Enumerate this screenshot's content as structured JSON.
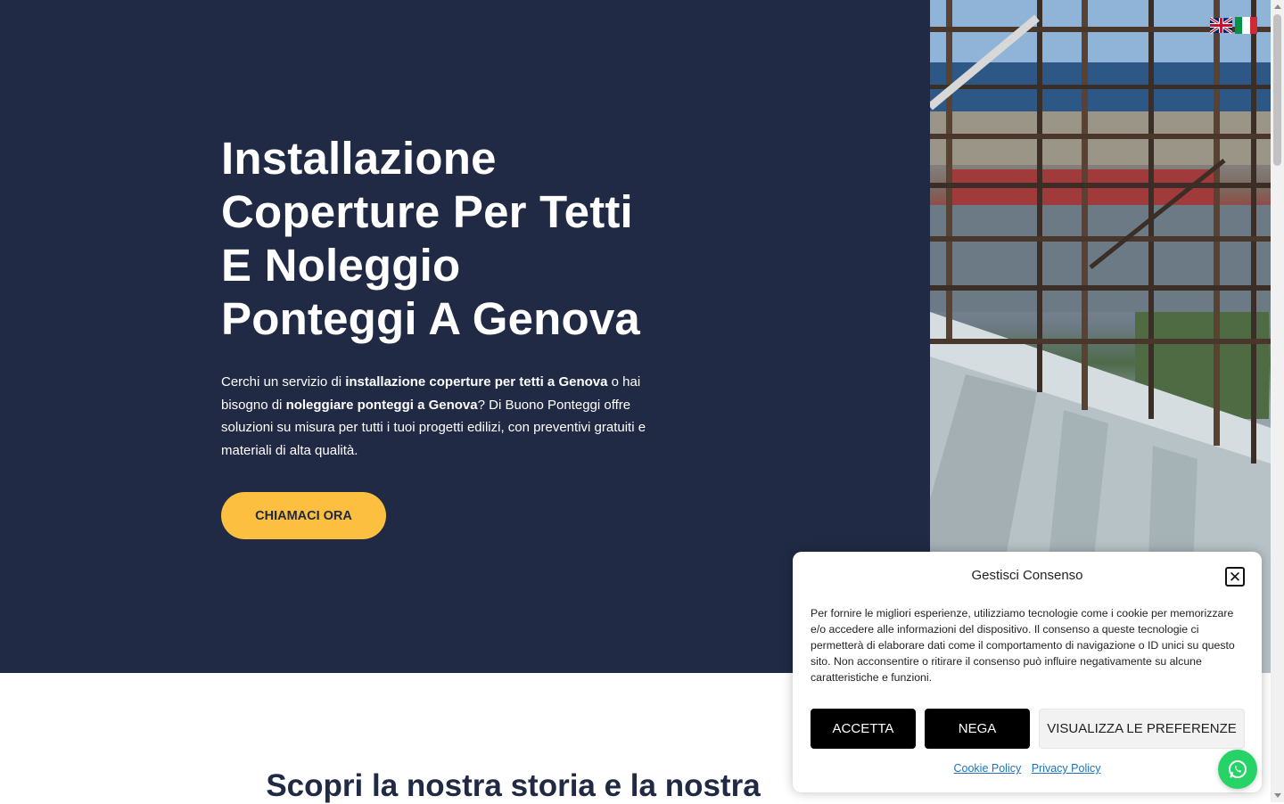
{
  "hero": {
    "title": "Installazione Coperture Per Tetti E Noleggio Ponteggi A Genova",
    "text_parts": [
      "Cerchi un servizio di ",
      "installazione coperture per tetti a Genova",
      " o hai bisogno di ",
      "noleggiare ponteggi a Genova",
      "? Di Buono Ponteggi offre soluzioni su misura per tutti i tuoi progetti edilizi, con preventivi gratuiti e materiali di alta qualità."
    ],
    "cta_label": "CHIAMACI ORA",
    "background_color": "#202a44",
    "cta_color": "#fdbf3f"
  },
  "language_switcher": {
    "flags": [
      "uk-flag-icon",
      "italy-flag-icon"
    ]
  },
  "section": {
    "title": "Scopri la nostra storia e la nostra"
  },
  "consent": {
    "title": "Gestisci Consenso",
    "text": "Per fornire le migliori esperienze, utilizziamo tecnologie come i cookie per memorizzare e/o accedere alle informazioni del dispositivo. Il consenso a queste tecnologie ci permetterà di elaborare dati come il comportamento di navigazione o ID unici su questo sito. Non acconsentire o ritirare il consenso può influire negativamente su alcune caratteristiche e funzioni.",
    "accept_label": "ACCETTA",
    "deny_label": "NEGA",
    "preferences_label": "VISUALIZZA LE PREFERENZE",
    "cookie_policy_label": "Cookie Policy",
    "privacy_policy_label": "Privacy Policy"
  },
  "icons": {
    "close": "close-icon",
    "whatsapp": "whatsapp-icon"
  }
}
